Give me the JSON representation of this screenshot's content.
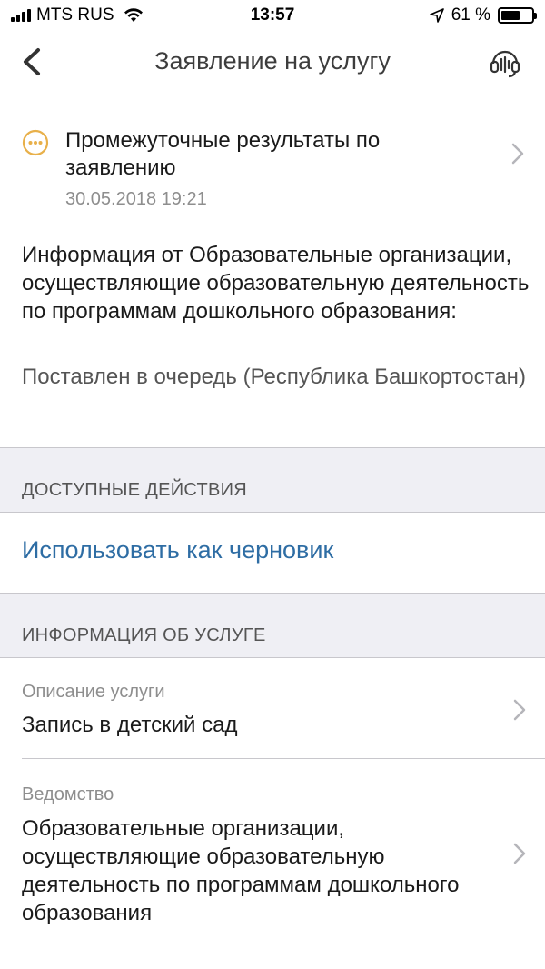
{
  "status_bar": {
    "carrier": "MTS RUS",
    "time": "13:57",
    "battery_percent": "61 %",
    "battery_level": 0.61
  },
  "nav": {
    "title": "Заявление на услугу",
    "back_icon": "chevron-left-icon",
    "support_icon": "headset-icon"
  },
  "status": {
    "icon": "dots-circle-icon",
    "accent_color": "#e8b04a",
    "title": "Промежуточные результаты по заявлению",
    "date": "30.05.2018 19:21"
  },
  "info": {
    "heading": "Информация от Образовательные организации, осуществляющие образовательную деятельность по программам дошкольного образования:",
    "value": "Поставлен в очередь (Республика Башкортостан)"
  },
  "actions_section": {
    "header": "ДОСТУПНЫЕ ДЕЙСТВИЯ",
    "link_label": "Использовать как черновик",
    "link_color": "#2e6da4"
  },
  "service_section": {
    "header": "ИНФОРМАЦИЯ ОБ УСЛУГЕ",
    "description_label": "Описание услуги",
    "description_value": "Запись в детский сад",
    "department_label": "Ведомство",
    "department_value": "Образовательные организации, осуществляющие образовательную деятельность по программам дошкольного образования"
  }
}
